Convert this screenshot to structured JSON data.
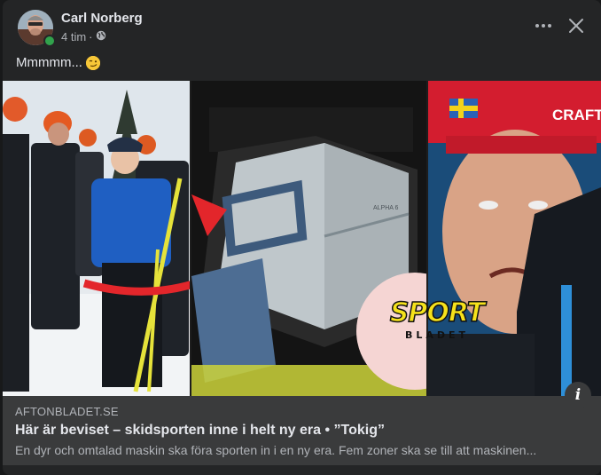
{
  "post": {
    "author": "Carl Norberg",
    "time": "4 tim",
    "separator": "·",
    "privacy_icon": "globe-icon",
    "text": "Mmmmm...",
    "emoji": "smirk-emoji"
  },
  "header_actions": {
    "more_icon": "more-options-icon",
    "close_icon": "close-icon"
  },
  "image": {
    "logo_line1": "SPORT",
    "logo_line2": "BLADET",
    "cap_text": "CRAFT",
    "device_label": "ALPHA 6"
  },
  "link_preview": {
    "domain": "AFTONBLADET.SE",
    "headline": "Här är beviset – skidsporten inne i helt ny era • ”Tokig”",
    "description": "En dyr och omtalad maskin ska föra sporten in i en ny era. Fem zoner ska se till att maskinen...",
    "info_label": "i"
  },
  "colors": {
    "card_bg": "#242526",
    "link_bg": "#3a3b3c",
    "online": "#31a24c",
    "logo_yellow": "#f5e21b"
  }
}
